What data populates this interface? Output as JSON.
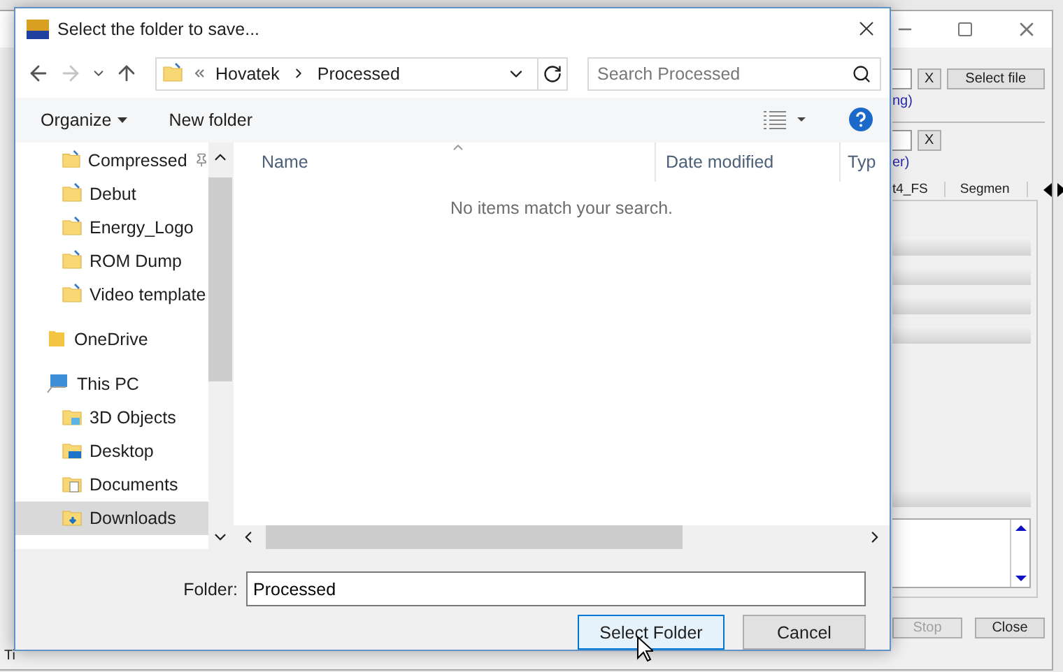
{
  "background_window": {
    "fields": [
      {
        "clear": "X",
        "button": "Select file",
        "link": "ng)"
      },
      {
        "clear": "X",
        "link": "er)"
      }
    ],
    "tabs": [
      "t4_FS",
      "Segmen"
    ],
    "buttons": [
      {
        "label": "Stop",
        "disabled": true
      },
      {
        "label": "Close",
        "disabled": false
      }
    ],
    "status_text": "Ti"
  },
  "dialog": {
    "title": "Select the folder to save...",
    "breadcrumb": [
      "Hovatek",
      "Processed"
    ],
    "search": {
      "placeholder": "Search Processed"
    },
    "toolbar": {
      "organize": "Organize",
      "new_folder": "New folder"
    },
    "quick_access": [
      {
        "label": "Compressed",
        "pinned": true,
        "selected": false
      },
      {
        "label": "Debut",
        "pinned": false,
        "selected": false
      },
      {
        "label": "Energy_Logo",
        "pinned": false,
        "selected": false
      },
      {
        "label": "ROM Dump",
        "pinned": false,
        "selected": false
      },
      {
        "label": "Video template",
        "pinned": false,
        "selected": false
      }
    ],
    "roots": [
      {
        "label": "OneDrive",
        "kind": "cloud",
        "selected": false
      },
      {
        "label": "This PC",
        "kind": "pc",
        "selected": false,
        "children": [
          {
            "label": "3D Objects",
            "kind": "objects",
            "selected": false
          },
          {
            "label": "Desktop",
            "kind": "desktop",
            "selected": false
          },
          {
            "label": "Documents",
            "kind": "documents",
            "selected": false
          },
          {
            "label": "Downloads",
            "kind": "downloads",
            "selected": true
          }
        ]
      }
    ],
    "columns": [
      "Name",
      "Date modified",
      "Typ"
    ],
    "empty_message": "No items match your search.",
    "folder": {
      "label": "Folder:",
      "value": "Processed"
    },
    "buttons": [
      {
        "label": "Select Folder",
        "kind": "primary"
      },
      {
        "label": "Cancel",
        "kind": "secondary"
      }
    ]
  }
}
